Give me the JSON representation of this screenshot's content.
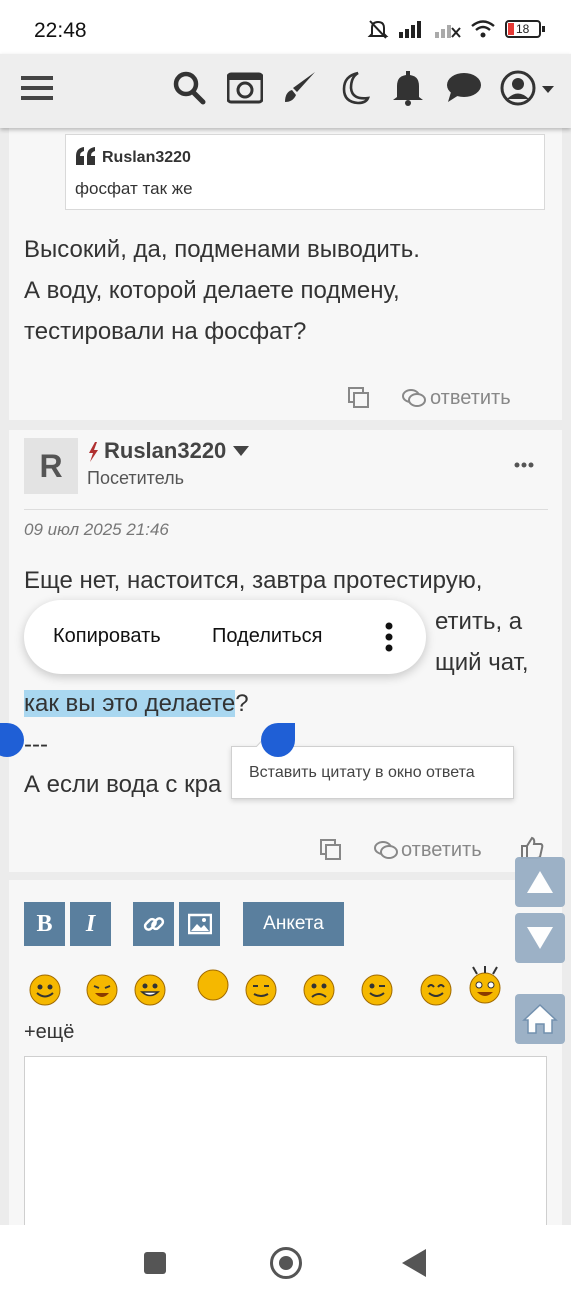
{
  "status_bar": {
    "time": "22:48",
    "battery": "18"
  },
  "toolbar": {
    "icons": [
      "menu-icon",
      "search-icon",
      "camera-icon",
      "brush-icon",
      "moon-icon",
      "bell-icon",
      "chat-icon",
      "user-icon"
    ]
  },
  "post1": {
    "quote_author": "Ruslan3220",
    "quote_text": "фосфат так же",
    "text": "Высокий, да, подменами выводить.\nА воду, которой делаете подмену,\nтестировали на фосфат?",
    "reply_label": "ответить"
  },
  "post2": {
    "avatar_letter": "R",
    "username": "Ruslan3220",
    "user_title": "Посетитель",
    "date": "09 июл 2025 21:46",
    "line1": "Еще нет, настоится, завтра протестирую,",
    "line2_end": "етить, а",
    "line3_end": "щий чат,",
    "selected_text": "как вы это делаете",
    "after_selection": "?",
    "separator": "---",
    "line5_start": "А если вода с кра",
    "reply_label": "ответить"
  },
  "context_menu": {
    "copy": "Копировать",
    "share": "Поделиться"
  },
  "tooltip": "Вставить цитату в окно ответа",
  "editor": {
    "bold": "B",
    "italic": "I",
    "poll": "Анкета",
    "more_smileys": "+ещё"
  },
  "colors": {
    "accent": "#5a7f9e",
    "selection": "#a9d7f0",
    "handle": "#1f5fd6",
    "smiley": "#f5b800"
  }
}
